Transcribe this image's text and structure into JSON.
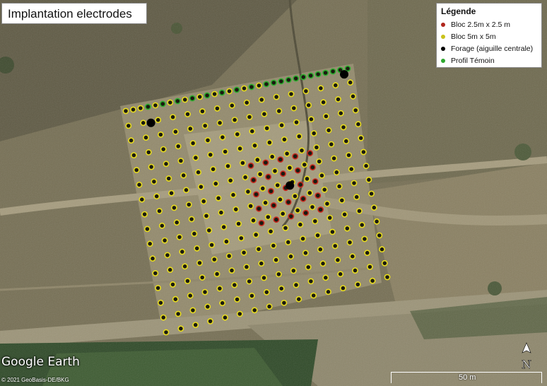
{
  "title": "Implantation electrodes",
  "legend": {
    "title": "Légende",
    "items": [
      {
        "label": "Bloc 2.5m x 2.5 m",
        "color": "#c0392b"
      },
      {
        "label": "Bloc 5m x 5m",
        "color": "#d4c81a"
      },
      {
        "label": "Forage (aiguille centrale)",
        "color": "#000000"
      },
      {
        "label": "Profil Témoin",
        "color": "#2fa82f"
      }
    ]
  },
  "watermark": "Google Earth",
  "copyright": "© 2021 GeoBasis-DE/BKG",
  "north_label": "N",
  "scale_label": "50 m",
  "colors": {
    "yellow": "#e8dc1e",
    "red": "#c8281e",
    "green": "#2fb02f",
    "black": "#000000"
  }
}
